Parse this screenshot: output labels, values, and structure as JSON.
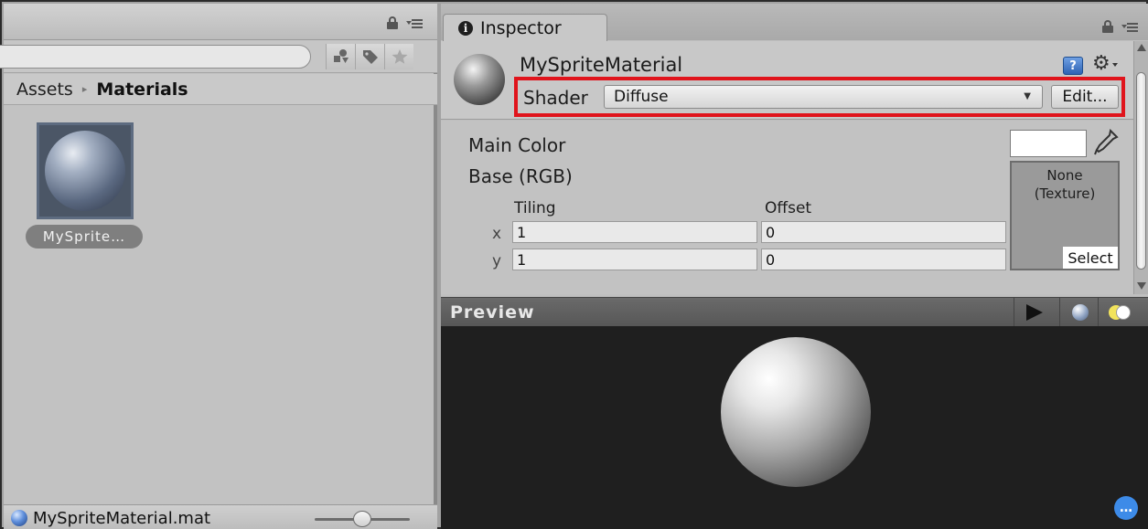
{
  "project": {
    "breadcrumb": {
      "root": "Assets",
      "separator": "▸",
      "current": "Materials"
    },
    "asset": {
      "label": "MySprite…"
    },
    "status_bar": {
      "file_name": "MySpriteMaterial.mat",
      "zoom_level": 0.5
    }
  },
  "inspector": {
    "tab_label": "Inspector",
    "info_glyph": "i",
    "material_name": "MySpriteMaterial",
    "help_glyph": "?",
    "gear_glyph": "⚙",
    "shader": {
      "label": "Shader",
      "value": "Diffuse",
      "dropdown_glyph": "▼",
      "edit_label": "Edit..."
    },
    "properties": {
      "main_color_label": "Main Color",
      "main_color_value": "#ffffff",
      "base_label": "Base (RGB)",
      "tiling_label": "Tiling",
      "offset_label": "Offset",
      "rows": [
        {
          "axis": "x",
          "tiling": "1",
          "offset": "0"
        },
        {
          "axis": "y",
          "tiling": "1",
          "offset": "0"
        }
      ],
      "texture_line1": "None",
      "texture_line2": "(Texture)",
      "texture_select": "Select"
    },
    "preview": {
      "title": "Preview",
      "chat_glyph": "…"
    }
  },
  "colors": {
    "highlight_border": "#e0141c",
    "help_icon": "#2e63b4",
    "material_icon": "#5e8edb",
    "chat_icon": "#3d8be8"
  },
  "icons": [
    "lock-icon",
    "panel-menu-icon",
    "search-by-type-icon",
    "search-by-label-icon",
    "favorites-star-icon",
    "material-icon",
    "info-icon",
    "help-icon",
    "gear-icon",
    "eyedropper-icon",
    "play-icon",
    "sphere-toggle-icon",
    "light-toggle-icon",
    "chat-icon"
  ]
}
